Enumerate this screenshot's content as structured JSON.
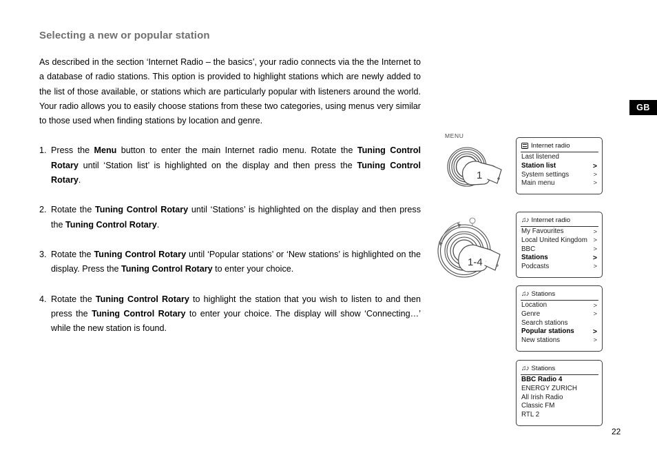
{
  "badge": {
    "text": "GB"
  },
  "page_number": "22",
  "heading": "Selecting a new or popular station",
  "intro": "As described in the section ‘Internet Radio – the basics’, your radio connects via the the Internet to a database of radio stations. This option is provided to highlight stations which are newly added to the list of those available, or stations which are particularly popular with listeners around the world. Your radio allows you to easily choose stations from these two categories, using menus very similar to those used when finding stations by location and genre.",
  "steps": [
    {
      "number": "1.",
      "parts": [
        {
          "t": "Press the ",
          "b": false
        },
        {
          "t": "Menu",
          "b": true
        },
        {
          "t": " button to enter the main Internet radio menu. Rotate the ",
          "b": false
        },
        {
          "t": "Tuning Control Rotary",
          "b": true
        },
        {
          "t": " until ‘Station list’ is highlighted on the display and then press the ",
          "b": false
        },
        {
          "t": "Tuning Control Rotary",
          "b": true
        },
        {
          "t": ".",
          "b": false
        }
      ]
    },
    {
      "number": "2.",
      "parts": [
        {
          "t": "Rotate the ",
          "b": false
        },
        {
          "t": "Tuning Control Rotary",
          "b": true
        },
        {
          "t": " until ‘Stations’ is highlighted on the display and then press the ",
          "b": false
        },
        {
          "t": "Tuning Control Rotary",
          "b": true
        },
        {
          "t": ".",
          "b": false
        }
      ]
    },
    {
      "number": "3.",
      "parts": [
        {
          "t": "Rotate the ",
          "b": false
        },
        {
          "t": "Tuning Control Rotary",
          "b": true
        },
        {
          "t": " until ‘Popular stations’ or ‘New stations’ is highlighted on the display. Press the ",
          "b": false
        },
        {
          "t": "Tuning Control Rotary",
          "b": true
        },
        {
          "t": " to enter your choice.",
          "b": false
        }
      ]
    },
    {
      "number": "4.",
      "parts": [
        {
          "t": "Rotate the ",
          "b": false
        },
        {
          "t": "Tuning Control Rotary",
          "b": true
        },
        {
          "t": " to highlight the station that you wish to listen to and then press the ",
          "b": false
        },
        {
          "t": "Tuning Control Rotary",
          "b": true
        },
        {
          "t": " to enter your choice. The display will show ‘Connecting…’ while the new station is found.",
          "b": false
        }
      ]
    }
  ],
  "illustrations": [
    {
      "name": "menu-button-press",
      "caption": "MENU",
      "hand_number": "1"
    },
    {
      "name": "tuning-control-rotary",
      "caption": "",
      "hand_number": "1-4"
    }
  ],
  "displays": [
    {
      "icon": "list-icon",
      "title": "Internet radio",
      "rows": [
        {
          "label": "Last listened",
          "chevron": false,
          "selected": false
        },
        {
          "label": "Station list",
          "chevron": true,
          "selected": true
        },
        {
          "label": "System settings",
          "chevron": true,
          "selected": false
        },
        {
          "label": "Main menu",
          "chevron": true,
          "selected": false
        }
      ]
    },
    {
      "icon": "music-note-icon",
      "title": "Internet radio",
      "rows": [
        {
          "label": "My Favourites",
          "chevron": true,
          "selected": false
        },
        {
          "label": "Local United Kingdom",
          "chevron": true,
          "selected": false
        },
        {
          "label": "BBC",
          "chevron": true,
          "selected": false
        },
        {
          "label": "Stations",
          "chevron": true,
          "selected": true
        },
        {
          "label": "Podcasts",
          "chevron": true,
          "selected": false
        }
      ]
    },
    {
      "icon": "music-note-icon",
      "title": "Stations",
      "rows": [
        {
          "label": "Location",
          "chevron": true,
          "selected": false
        },
        {
          "label": "Genre",
          "chevron": true,
          "selected": false
        },
        {
          "label": "Search stations",
          "chevron": false,
          "selected": false
        },
        {
          "label": "Popular stations",
          "chevron": true,
          "selected": true
        },
        {
          "label": "New stations",
          "chevron": true,
          "selected": false
        }
      ]
    },
    {
      "icon": "music-note-icon",
      "title": "Stations",
      "rows": [
        {
          "label": "BBC Radio 4",
          "chevron": false,
          "selected": true
        },
        {
          "label": "ENERGY ZURICH",
          "chevron": false,
          "selected": false
        },
        {
          "label": "All Irish Radio",
          "chevron": false,
          "selected": false
        },
        {
          "label": "Classic FM",
          "chevron": false,
          "selected": false
        },
        {
          "label": "RTL 2",
          "chevron": false,
          "selected": false
        }
      ]
    }
  ],
  "colors": {
    "heading": "#6f6f6f",
    "text": "#000000",
    "lcd_border": "#3c3c3c",
    "badge_bg": "#000000"
  }
}
